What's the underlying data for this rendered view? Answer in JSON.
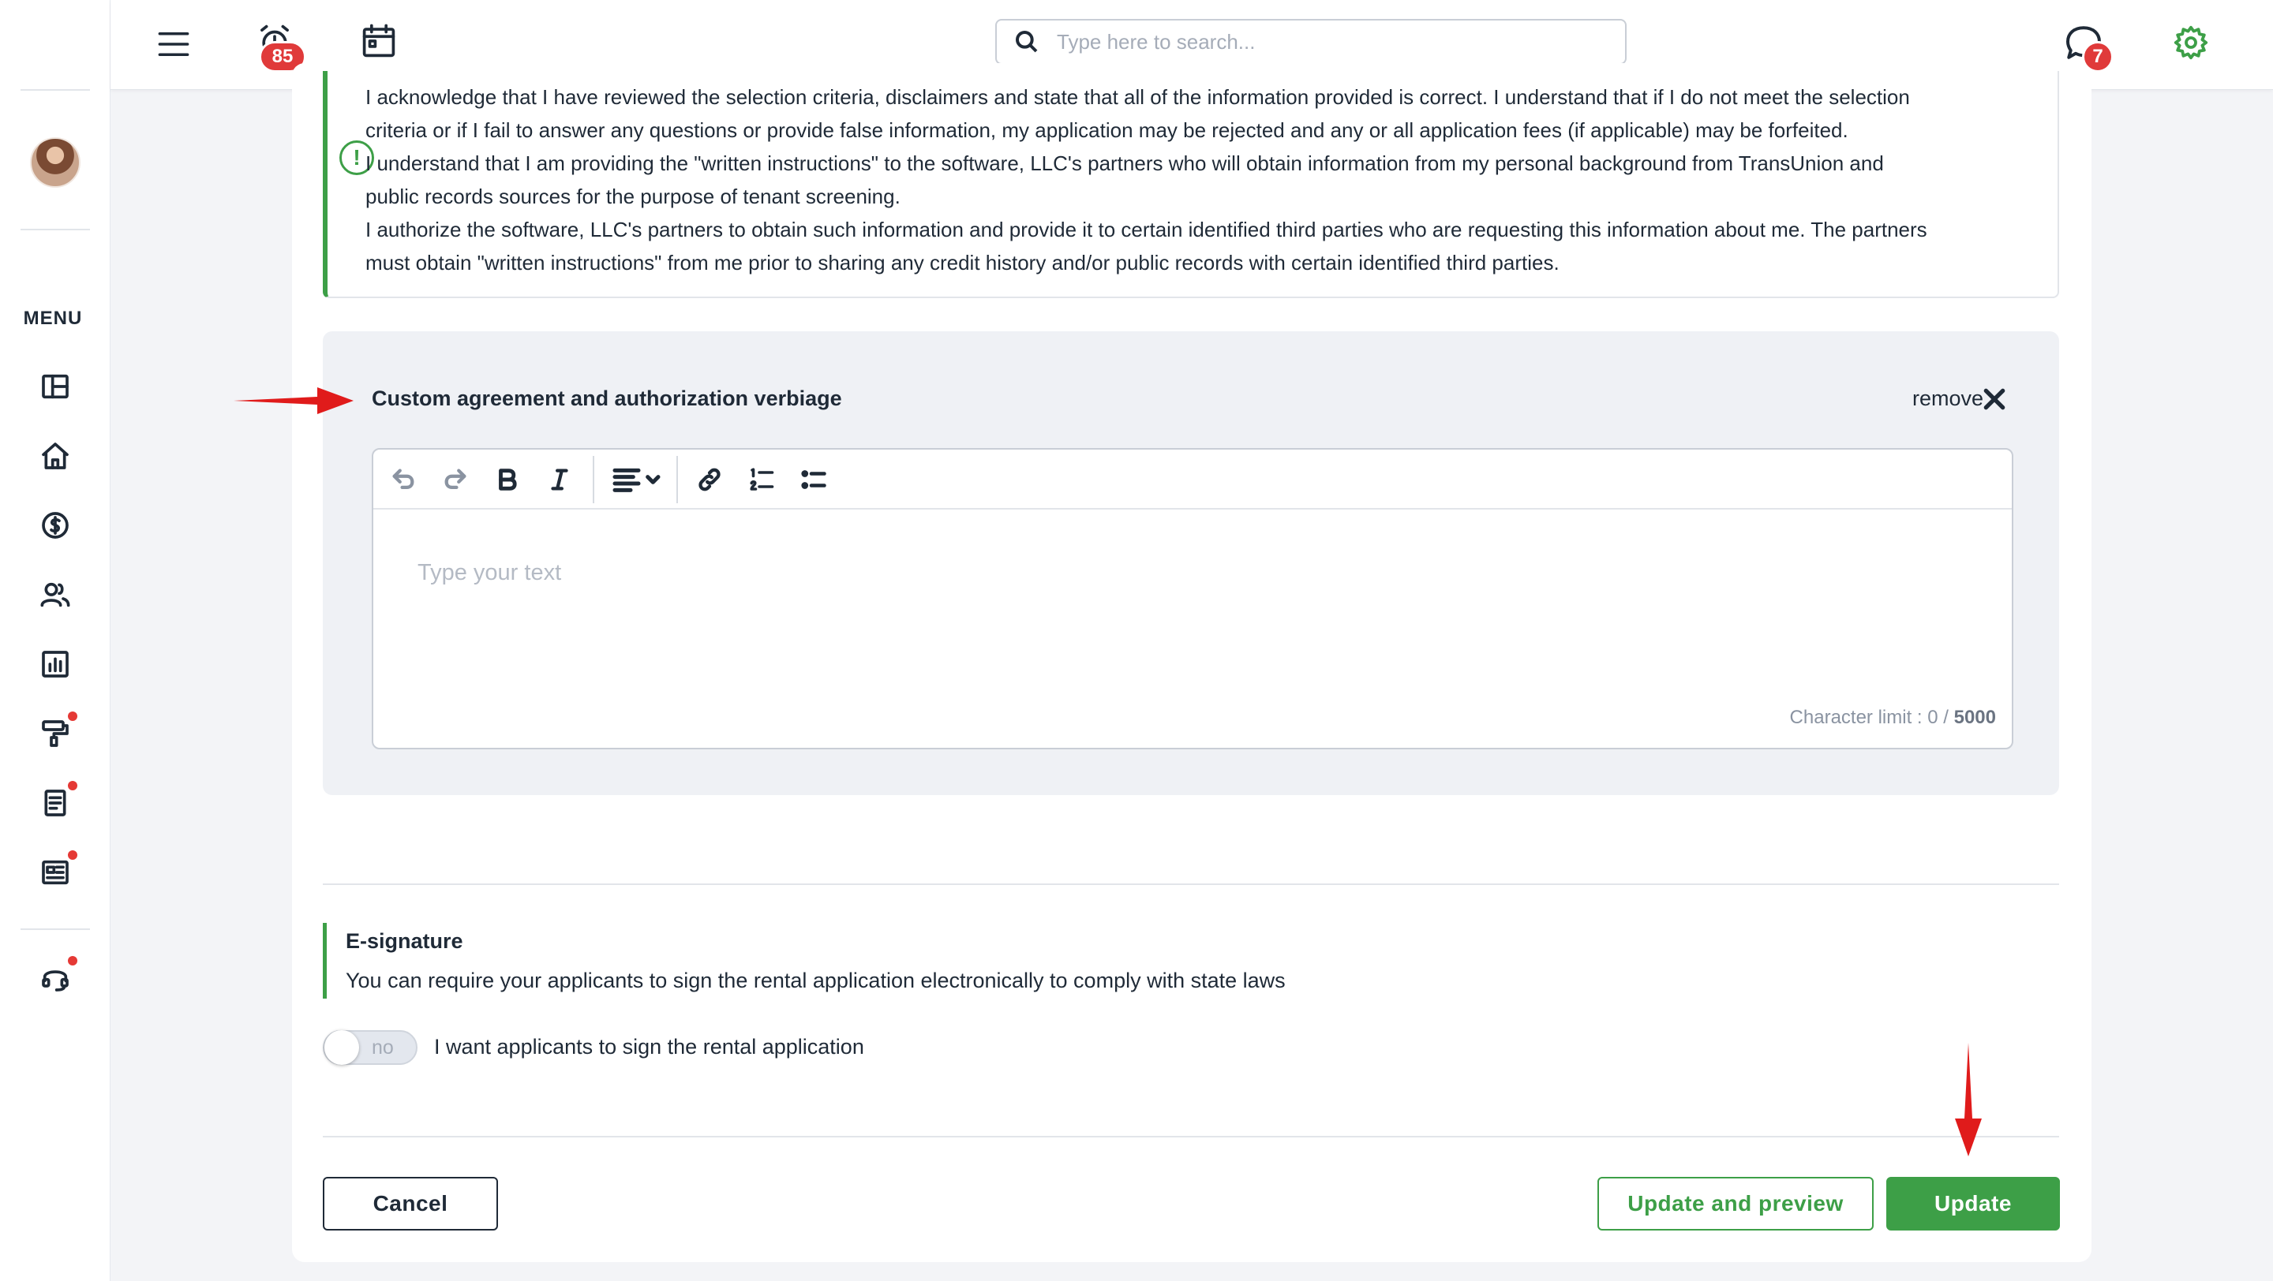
{
  "header": {
    "notifications_count": "85",
    "messages_count": "7",
    "search_placeholder": "Type here to search..."
  },
  "sidebar": {
    "menu_label": "MENU",
    "items": [
      {
        "icon": "dashboard-icon"
      },
      {
        "icon": "home-icon"
      },
      {
        "icon": "dollar-icon"
      },
      {
        "icon": "users-icon"
      },
      {
        "icon": "reports-icon"
      },
      {
        "icon": "paint-roller-icon",
        "dot": true
      },
      {
        "icon": "document-icon",
        "dot": true
      },
      {
        "icon": "news-icon",
        "dot": true
      },
      {
        "icon": "support-headset-icon",
        "dot": true
      }
    ]
  },
  "disclaimer": {
    "lines": [
      "I acknowledge that I have reviewed the selection criteria, disclaimers and state that all of the information provided is correct. I understand that if I do not meet the selection",
      "criteria or if I fail to answer any questions or provide false information, my application may be rejected and any or all application fees (if applicable) may be forfeited.",
      "I understand that I am providing the \"written instructions\" to the software, LLC's partners who will obtain information from my personal background from TransUnion and",
      "public records sources for the purpose of tenant screening.",
      "I authorize the software, LLC's partners to obtain such information and provide it to certain identified third parties who are requesting this information about me. The partners",
      "must obtain \"written instructions\" from me prior to sharing any credit history and/or public records with certain identified third parties."
    ]
  },
  "custom_agreement": {
    "title": "Custom agreement and authorization verbiage",
    "remove_label": "remove",
    "editor_placeholder": "Type your text",
    "char_limit_label": "Character limit : 0 / ",
    "char_limit_max": "5000"
  },
  "esignature": {
    "title": "E-signature",
    "description": "You can require your applicants to sign the rental application electronically to comply with state laws",
    "toggle_state": "no",
    "toggle_label": "I want applicants to sign the rental application"
  },
  "actions": {
    "cancel": "Cancel",
    "update_preview": "Update and preview",
    "update": "Update"
  },
  "colors": {
    "accent_green": "#3d9f47",
    "badge_red": "#e03a3a",
    "annotation_red": "#e01b1b"
  }
}
